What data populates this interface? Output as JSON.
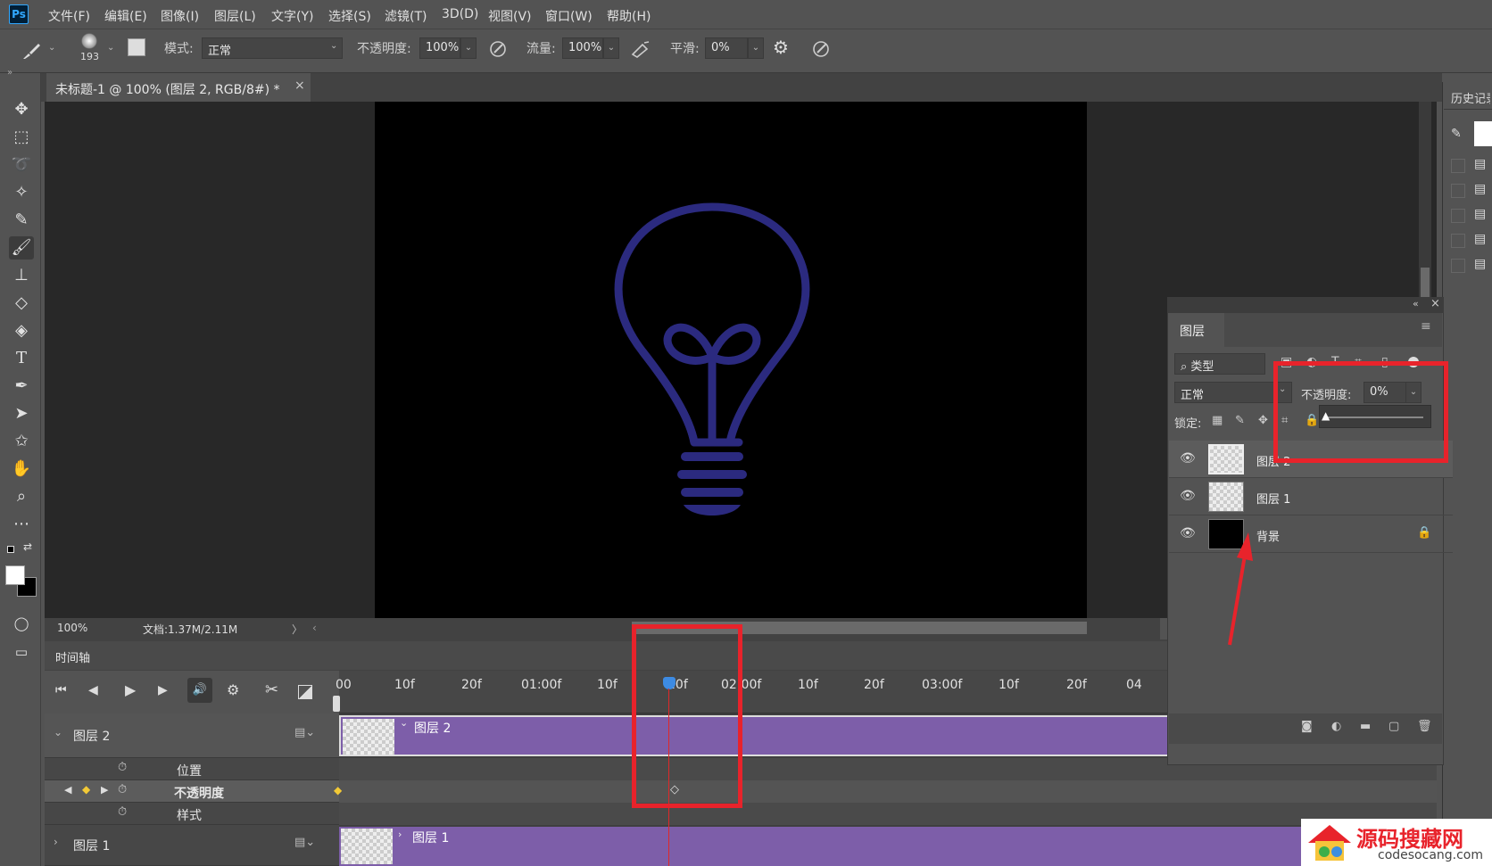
{
  "app": {
    "logo": "Ps"
  },
  "menubar": [
    "文件(F)",
    "编辑(E)",
    "图像(I)",
    "图层(L)",
    "文字(Y)",
    "选择(S)",
    "滤镜(T)",
    "3D(D)",
    "视图(V)",
    "窗口(W)",
    "帮助(H)"
  ],
  "options": {
    "brush_size": "193",
    "mode_label": "模式:",
    "mode_value": "正常",
    "opacity_label": "不透明度:",
    "opacity_value": "100%",
    "flow_label": "流量:",
    "flow_value": "100%",
    "smooth_label": "平滑:",
    "smooth_value": "0%"
  },
  "document": {
    "tab_title": "未标题-1 @ 100% (图层 2, RGB/8#) *",
    "zoom": "100%",
    "doc_info": "文档:1.37M/2.11M"
  },
  "timeline": {
    "title": "时间轴",
    "ruler": [
      "00",
      "10f",
      "20f",
      "01:00f",
      "10f",
      "20f",
      "02:00f",
      "10f",
      "20f",
      "03:00f",
      "10f",
      "20f",
      "04"
    ],
    "ruler_marker": "??f",
    "tracks": {
      "layer2": "图层 2",
      "position": "位置",
      "opacity": "不透明度",
      "style": "样式",
      "layer1": "图层 1"
    },
    "clip_layer2": "图层 2",
    "clip_layer1": "图层 1"
  },
  "layers_panel": {
    "title": "图层",
    "filter_kind": "类型",
    "blend_mode": "正常",
    "opacity_label": "不透明度:",
    "opacity_value": "0%",
    "lock_label": "锁定:",
    "layers": [
      {
        "name": "图层 2"
      },
      {
        "name": "图层 1"
      },
      {
        "name": "背景"
      }
    ]
  },
  "history_panel": {
    "title": "历史记录"
  },
  "watermark": {
    "name": "源码搜藏网",
    "domain": "codesocang.com"
  },
  "colors": {
    "bulb": "#2b2a7f",
    "clip": "#7d5ea9",
    "highlight": "#e8232b"
  }
}
